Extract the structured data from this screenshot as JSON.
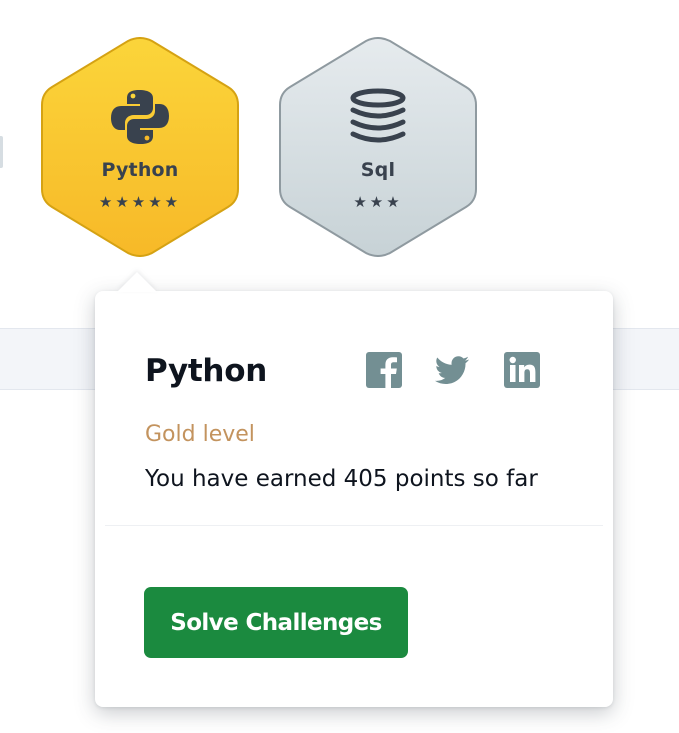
{
  "badges": [
    {
      "name": "Python",
      "stars": "★★★★★",
      "star_count": 5,
      "icon": "python-logo-icon",
      "fill_top": "#fbd53a",
      "fill_bottom": "#f7b928",
      "border": "#d5a213"
    },
    {
      "name": "Sql",
      "stars": "★★★",
      "star_count": 3,
      "icon": "database-icon",
      "fill_top": "#e6ebee",
      "fill_bottom": "#c7d2d6",
      "border": "#8f9aa0"
    }
  ],
  "popover": {
    "title": "Python",
    "level": "Gold level",
    "points_text": "You have earned 405 points so far",
    "share_icons": [
      "facebook-icon",
      "twitter-icon",
      "linkedin-icon"
    ],
    "button_label": "Solve Challenges",
    "button_color": "#1b8a3f",
    "level_color": "#c3935e",
    "icon_color": "#738f93"
  }
}
